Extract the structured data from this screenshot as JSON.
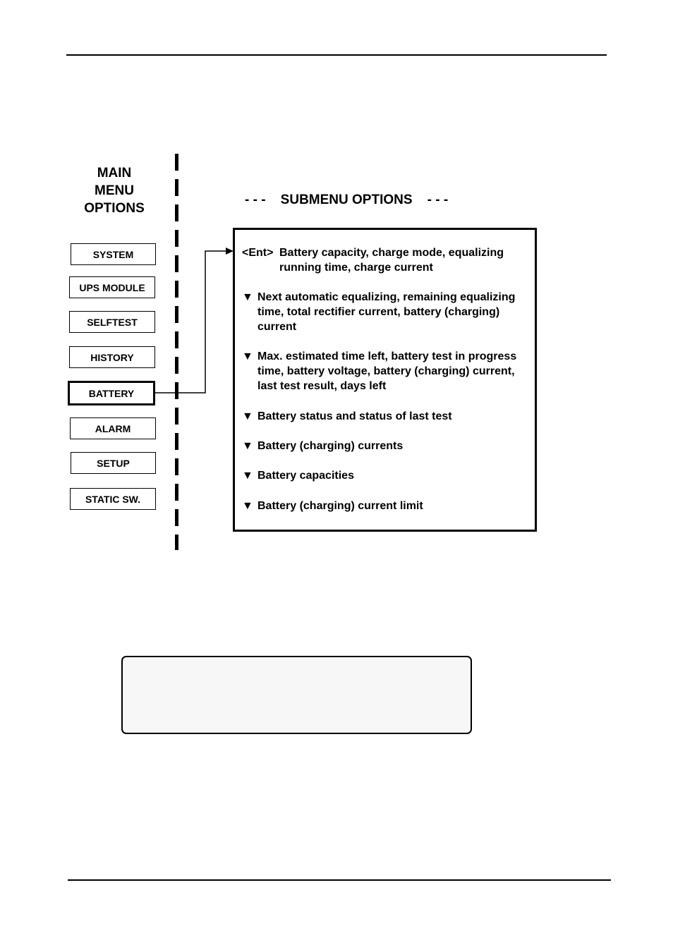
{
  "main_menu": {
    "title_lines": [
      "MAIN",
      "MENU",
      "OPTIONS"
    ],
    "items": [
      {
        "label": "SYSTEM",
        "active": false
      },
      {
        "label": "UPS MODULE",
        "active": false
      },
      {
        "label": "SELFTEST",
        "active": false
      },
      {
        "label": "HISTORY",
        "active": false
      },
      {
        "label": "BATTERY",
        "active": true
      },
      {
        "label": "ALARM",
        "active": false
      },
      {
        "label": "SETUP",
        "active": false
      },
      {
        "label": "STATIC SW.",
        "active": false
      }
    ]
  },
  "submenu": {
    "title": "SUBMENU OPTIONS",
    "title_dashes": "- - -",
    "ent_marker": "<Ent>",
    "down_marker": "▼",
    "items": [
      {
        "marker": "<Ent>",
        "text": "Battery capacity, charge mode, equalizing running time, charge current"
      },
      {
        "marker": "▼",
        "text": "Next automatic equalizing, remaining equalizing time, total rectifier current, battery (charging) current"
      },
      {
        "marker": "▼",
        "text": "Max. estimated time left, battery test in progress time, battery voltage, battery (charging) current, last test result, days left"
      },
      {
        "marker": "▼",
        "text": "Battery status and status of last test"
      },
      {
        "marker": "▼",
        "text": "Battery (charging) currents"
      },
      {
        "marker": "▼",
        "text": "Battery capacities"
      },
      {
        "marker": "▼",
        "text": "Battery (charging) current limit"
      }
    ]
  },
  "display": {
    "text": ""
  }
}
